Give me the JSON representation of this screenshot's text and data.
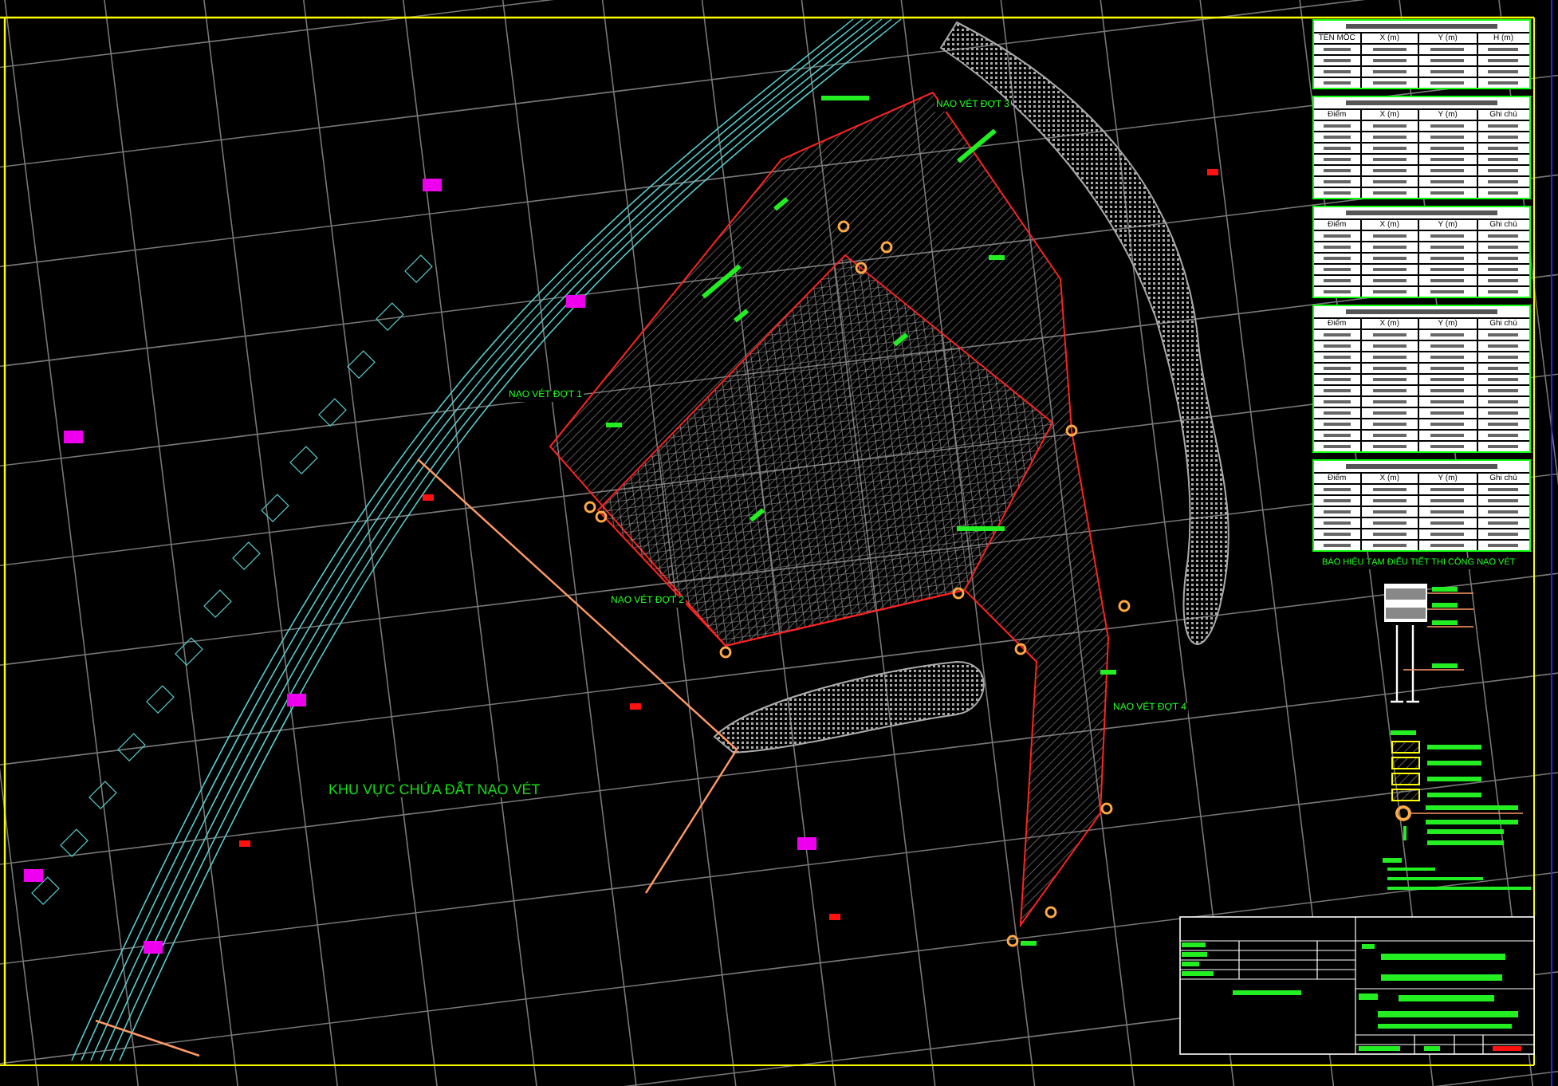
{
  "map_labels": [
    {
      "kind": "zone",
      "text": "NẠO VÉT ĐỢT 1"
    },
    {
      "kind": "zone",
      "text": "NẠO VÉT ĐỢT 2"
    },
    {
      "kind": "zone",
      "text": "NẠO VÉT ĐỢT 3"
    },
    {
      "kind": "zone",
      "text": "NẠO VÉT ĐỢT 4"
    },
    {
      "kind": "area",
      "text": "KHU VỰC CHỨA ĐẤT NẠO VÉT"
    }
  ],
  "tables": [
    {
      "columns": [
        "TÊN MỐC",
        "X (m)",
        "Y (m)",
        "H (m)"
      ]
    },
    {
      "columns": [
        "Điểm",
        "X (m)",
        "Y (m)",
        "Ghi chú"
      ]
    },
    {
      "columns": [
        "Điểm",
        "X (m)",
        "Y (m)",
        "Ghi chú"
      ]
    },
    {
      "columns": [
        "Điểm",
        "X (m)",
        "Y (m)",
        "Ghi chú"
      ]
    },
    {
      "columns": [
        "Điểm",
        "X (m)",
        "Y (m)",
        "Ghi chú"
      ]
    }
  ],
  "legend": {
    "title": "BÁO HIỆU TẠM ĐIỂU TIẾT THI CÔNG NẠO VÉT"
  }
}
